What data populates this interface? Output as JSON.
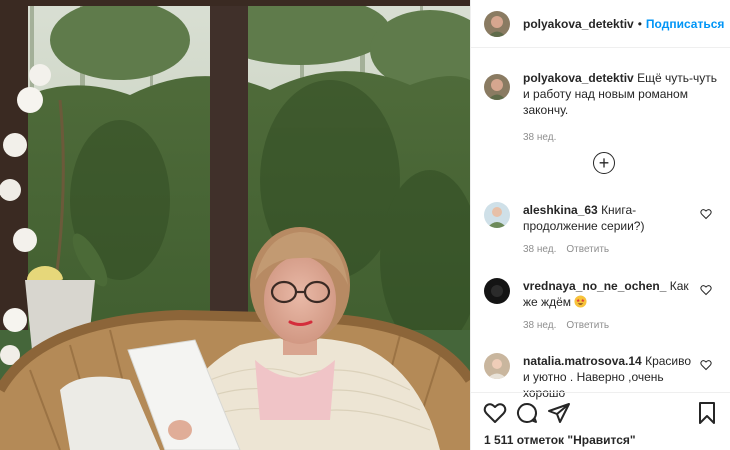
{
  "post": {
    "author": "polyakova_detektiv",
    "dot": "•",
    "follow_label": "Подписаться",
    "caption": "Ещё чуть-чуть и работу над новым романом закончу.",
    "caption_time": "38 нед.",
    "load_more_symbol": "+"
  },
  "comments": [
    {
      "username": "aleshkina_63",
      "text": "Книга- продолжение серии?)",
      "time": "38 нед.",
      "reply": "Ответить"
    },
    {
      "username": "vrednaya_no_ne_ochen_",
      "text": "Как же ждём",
      "emoji": "star-struck-emoji",
      "time": "38 нед.",
      "reply": "Ответить"
    },
    {
      "username": "natalia.matrosova.14",
      "text": "Красиво и уютно . Наверно ,очень хорошо"
    }
  ],
  "actions": {
    "icons": [
      "heart-icon",
      "comment-icon",
      "share-icon",
      "bookmark-icon"
    ],
    "likes": "1 511 отметок \"Нравится\""
  },
  "colors": {
    "link": "#0095f6",
    "text": "#262626",
    "muted": "#8e8e8e",
    "border": "#efefef"
  }
}
